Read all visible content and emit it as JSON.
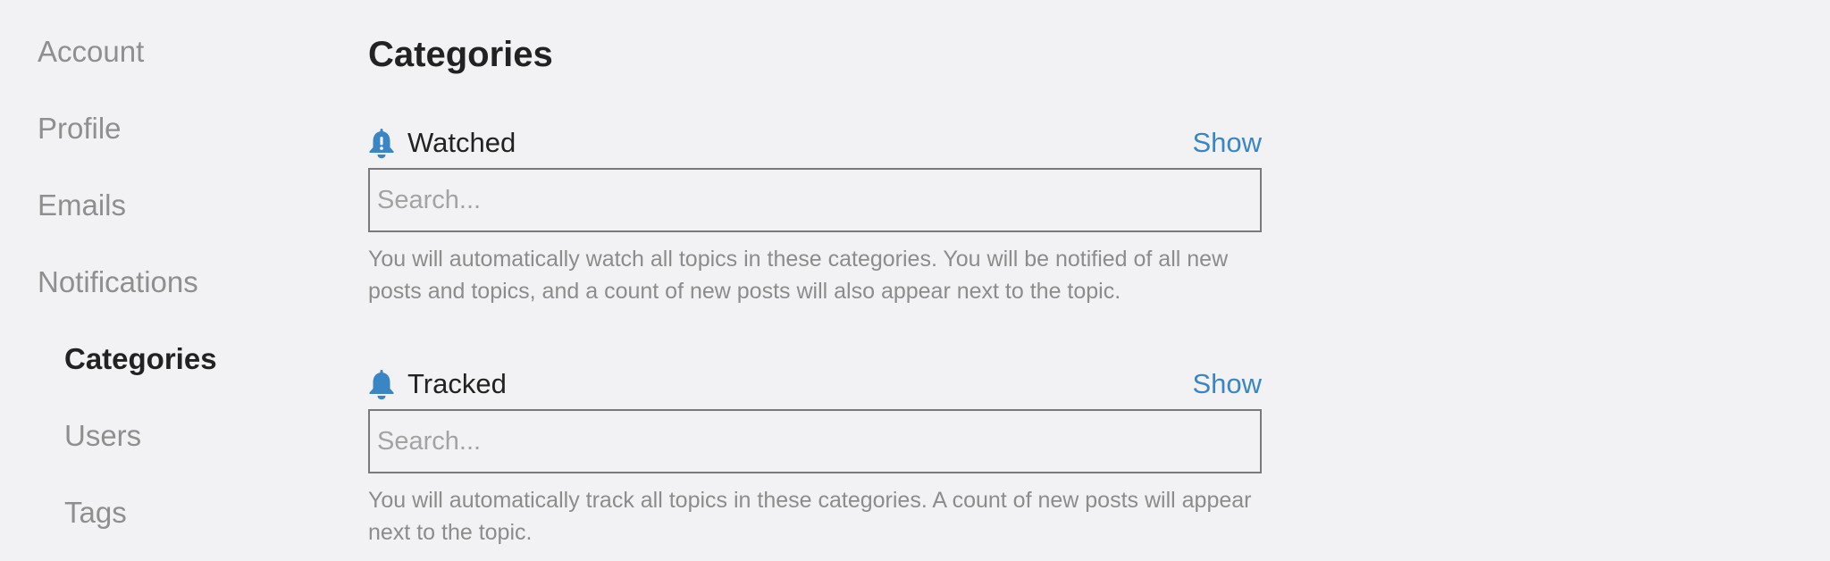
{
  "sidebar": {
    "items": [
      {
        "label": "Account"
      },
      {
        "label": "Profile"
      },
      {
        "label": "Emails"
      },
      {
        "label": "Notifications"
      },
      {
        "label": "Categories"
      },
      {
        "label": "Users"
      },
      {
        "label": "Tags"
      }
    ]
  },
  "main": {
    "title": "Categories",
    "sections": [
      {
        "label": "Watched",
        "icon": "bell-alert-icon",
        "show_label": "Show",
        "search_placeholder": "Search...",
        "help": "You will automatically watch all topics in these categories. You will be notified of all new posts and topics, and a count of new posts will also appear next to the topic."
      },
      {
        "label": "Tracked",
        "icon": "bell-icon",
        "show_label": "Show",
        "search_placeholder": "Search...",
        "help": "You will automatically track all topics in these categories. A count of new posts will appear next to the topic."
      }
    ]
  },
  "colors": {
    "background": "#f2f2f4",
    "link": "#3a86c4",
    "icon": "#3a86c4",
    "muted_text": "#8c8c8c",
    "active_text": "#222222"
  }
}
